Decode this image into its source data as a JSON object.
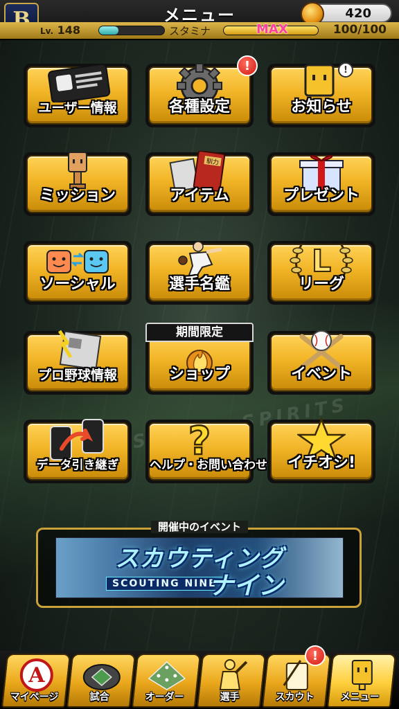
{
  "header": {
    "title": "メニュー",
    "team_logo_letter": "B",
    "coins": "420",
    "level_prefix": "Lv.",
    "level": "148",
    "stamina_label": "スタミナ",
    "stamina_max_label": "MAX",
    "stamina_value": "100/100",
    "exp_fill_fraction": 0.3,
    "stamina_fill_fraction": 1.0
  },
  "menu": {
    "user_info": "ユーザー情報",
    "settings": "各種設定",
    "settings_badge": "!",
    "notices": "お知らせ",
    "notices_badge": "!",
    "mission": "ミッション",
    "item": "アイテム",
    "item_book_text": "馴力",
    "present": "プレゼント",
    "social": "ソーシャル",
    "player_directory": "選手名鑑",
    "league": "リーグ",
    "league_letter": "L",
    "pro_baseball_info": "プロ野球情報",
    "shop": "ショップ",
    "shop_tag": "期間限定",
    "event": "イベント",
    "data_transfer": "データ引き継ぎ",
    "help": "ヘルプ・お問い合わせ",
    "recommend": "イチオシ!"
  },
  "event": {
    "section_title": "開催中のイベント",
    "banner_main": "スカウティング",
    "banner_sub": "ナイン",
    "banner_en": "SCOUTING NINE"
  },
  "nav": {
    "mypage": "マイページ",
    "mypage_letter": "A",
    "match": "試合",
    "order": "オーダー",
    "player": "選手",
    "scout": "スカウト",
    "scout_badge": "!",
    "menu": "メニュー"
  },
  "colors": {
    "button_gold": "#f1b426",
    "badge_red": "#d11a10",
    "max_pink": "#ff3fa0"
  }
}
